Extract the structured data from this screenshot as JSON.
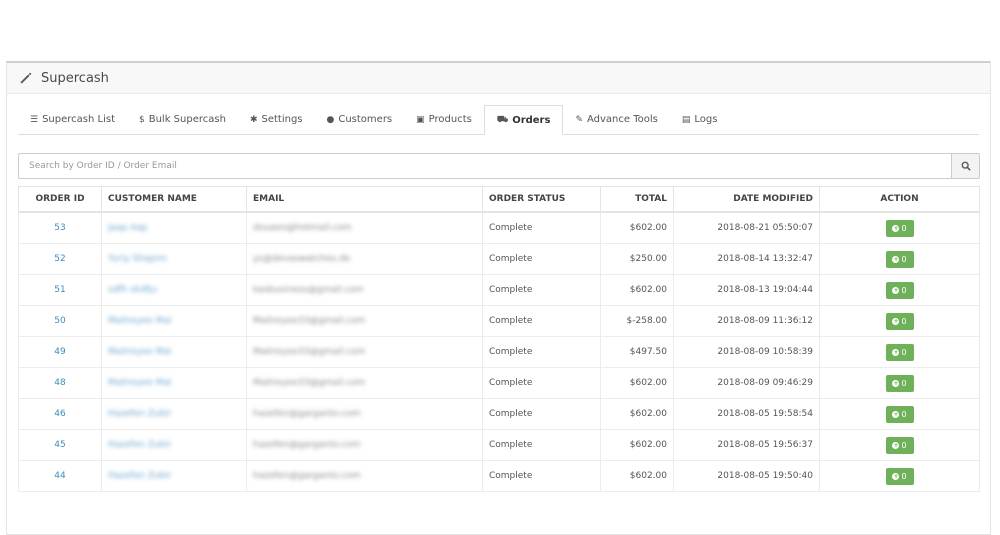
{
  "header": {
    "title": "Supercash",
    "icon": "pencil-icon"
  },
  "tabs": [
    {
      "label": "Supercash List",
      "icon": "list-icon",
      "glyph": "☰"
    },
    {
      "label": "Bulk Supercash",
      "icon": "dollar-icon",
      "glyph": "$"
    },
    {
      "label": "Settings",
      "icon": "gear-icon",
      "glyph": "✱"
    },
    {
      "label": "Customers",
      "icon": "user-icon",
      "glyph": "●"
    },
    {
      "label": "Products",
      "icon": "gift-icon",
      "glyph": "▣"
    },
    {
      "label": "Orders",
      "icon": "cart-icon",
      "glyph": "⛟",
      "active": true
    },
    {
      "label": "Advance Tools",
      "icon": "wrench-icon",
      "glyph": "✎"
    },
    {
      "label": "Logs",
      "icon": "book-icon",
      "glyph": "▤"
    }
  ],
  "search": {
    "placeholder": "Search by Order ID / Order Email",
    "value": ""
  },
  "table": {
    "headers": [
      "ORDER ID",
      "CUSTOMER NAME",
      "EMAIL",
      "ORDER STATUS",
      "TOTAL",
      "DATE MODIFIED",
      "ACTION"
    ],
    "rows": [
      {
        "id": "53",
        "name": "Jaap Aap",
        "email": "douaeo@hotmail.com",
        "status": "Complete",
        "total": "$602.00",
        "date": "2018-08-21 05:50:07",
        "action": "0"
      },
      {
        "id": "52",
        "name": "Yuriy Shapiro",
        "email": "ys@devaswatches.de",
        "status": "Complete",
        "total": "$250.00",
        "date": "2018-08-14 13:32:47",
        "action": "0"
      },
      {
        "id": "51",
        "name": "sdfh skdfju",
        "email": "kasbusiness@gmail.com",
        "status": "Complete",
        "total": "$602.00",
        "date": "2018-08-13 19:04:44",
        "action": "0"
      },
      {
        "id": "50",
        "name": "Maitreyee Mal",
        "email": "Maitreyee33@gmail.com",
        "status": "Complete",
        "total": "$-258.00",
        "date": "2018-08-09 11:36:12",
        "action": "0"
      },
      {
        "id": "49",
        "name": "Maitreyee Mal",
        "email": "Maitreyee33@gmail.com",
        "status": "Complete",
        "total": "$497.50",
        "date": "2018-08-09 10:58:39",
        "action": "0"
      },
      {
        "id": "48",
        "name": "Maitreyee Mal",
        "email": "Maitreyee33@gmail.com",
        "status": "Complete",
        "total": "$602.00",
        "date": "2018-08-09 09:46:29",
        "action": "0"
      },
      {
        "id": "46",
        "name": "Hazefen Zubir",
        "email": "hazefen@garganto.com",
        "status": "Complete",
        "total": "$602.00",
        "date": "2018-08-05 19:58:54",
        "action": "0"
      },
      {
        "id": "45",
        "name": "Hazefen Zubir",
        "email": "hazefen@garganto.com",
        "status": "Complete",
        "total": "$602.00",
        "date": "2018-08-05 19:56:37",
        "action": "0"
      },
      {
        "id": "44",
        "name": "Hazefen Zubir",
        "email": "hazefen@garganto.com",
        "status": "Complete",
        "total": "$602.00",
        "date": "2018-08-05 19:50:40",
        "action": "0"
      }
    ]
  },
  "colors": {
    "action_button": "#6fb15a",
    "link": "#3c8dbc"
  }
}
